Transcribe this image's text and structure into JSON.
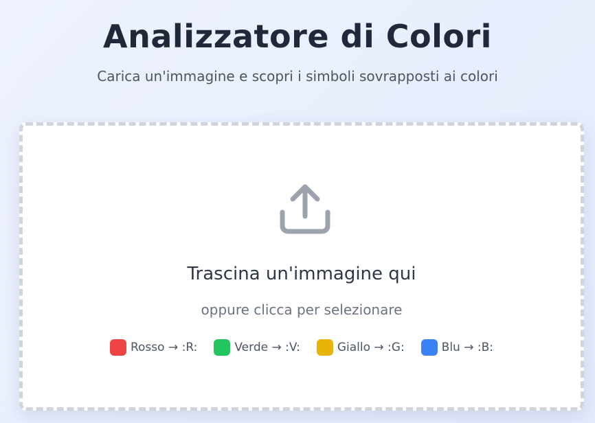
{
  "header": {
    "title": "Analizzatore di Colori",
    "subtitle": "Carica un'immagine e scopri i simboli sovrapposti ai colori"
  },
  "dropzone": {
    "icon": "upload-icon",
    "title": "Trascina un'immagine qui",
    "subtitle": "oppure clicca per selezionare"
  },
  "legend": [
    {
      "label": "Rosso → :R:",
      "color": "#ef4444"
    },
    {
      "label": "Verde → :V:",
      "color": "#22c55e"
    },
    {
      "label": "Giallo → :G:",
      "color": "#eab308"
    },
    {
      "label": "Blu → :B:",
      "color": "#3b82f6"
    }
  ]
}
